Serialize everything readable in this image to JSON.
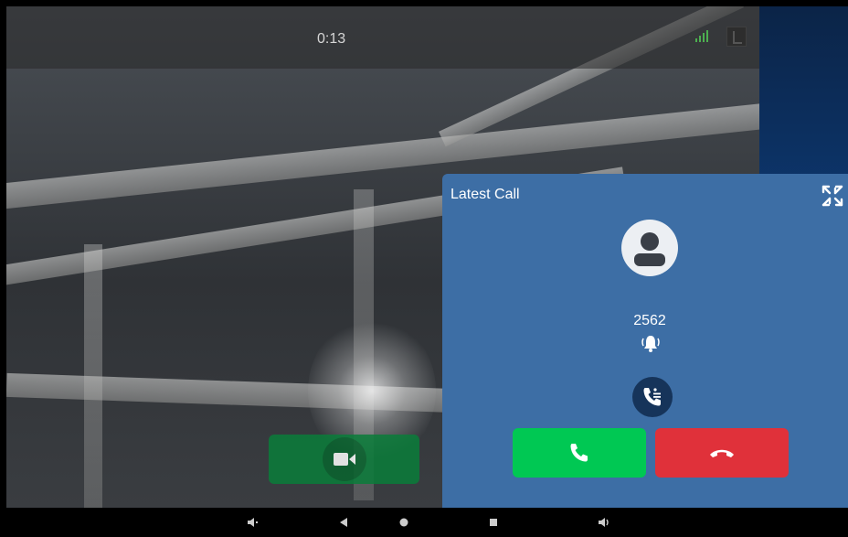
{
  "call": {
    "duration": "0:13"
  },
  "status_bar": {
    "signal_color": "#4caf50"
  },
  "latest_call": {
    "title": "Latest Call",
    "caller_number": "2562",
    "panel_color": "#3d6ea5",
    "answer_color": "#00c853",
    "decline_color": "#e0313a"
  },
  "controls": {
    "video_button_color": "#0a7d3a"
  },
  "icons": {
    "collapse": "collapse-icon",
    "avatar": "person-avatar-icon",
    "bell": "ringing-bell-icon",
    "transfer": "call-transfer-icon",
    "answer": "phone-answer-icon",
    "decline": "phone-hangup-icon",
    "video": "video-camera-icon",
    "vol_down": "volume-down-icon",
    "back": "back-triangle-icon",
    "home": "home-circle-icon",
    "recents": "recents-square-icon",
    "vol_up": "volume-up-icon"
  }
}
